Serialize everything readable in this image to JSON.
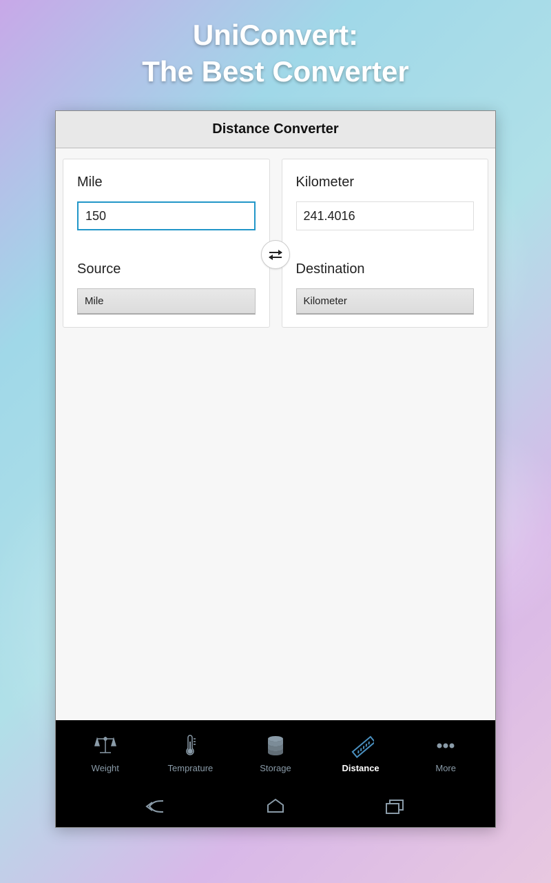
{
  "promo": {
    "line1": "UniConvert:",
    "line2": "The Best Converter"
  },
  "header": {
    "title": "Distance Converter"
  },
  "converter": {
    "from_label": "Mile",
    "from_value": "150",
    "to_label": "Kilometer",
    "to_value": "241.4016",
    "source_label": "Source",
    "source_unit": "Mile",
    "destination_label": "Destination",
    "destination_unit": "Kilometer"
  },
  "tabs": [
    {
      "label": "Weight",
      "icon": "scale-icon"
    },
    {
      "label": "Temprature",
      "icon": "thermometer-icon"
    },
    {
      "label": "Storage",
      "icon": "database-icon"
    },
    {
      "label": "Distance",
      "icon": "ruler-icon",
      "active": true
    },
    {
      "label": "More",
      "icon": "more-icon"
    }
  ],
  "colors": {
    "accent": "#2196c8",
    "tab_inactive": "#8a9ba8",
    "tab_active_icon": "#4a90c0"
  }
}
